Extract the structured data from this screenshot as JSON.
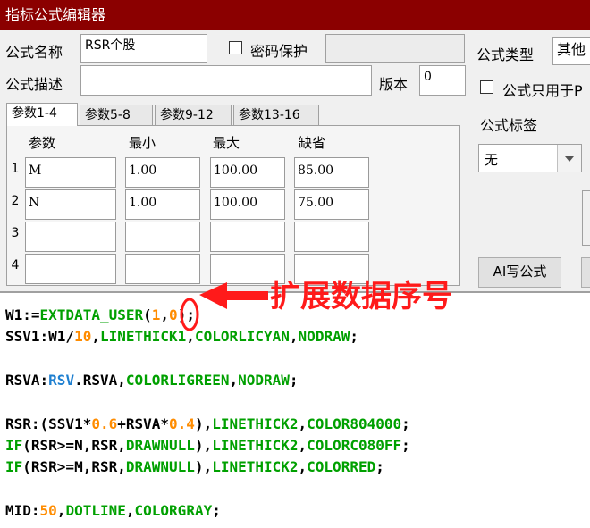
{
  "window": {
    "title": "指标公式编辑器"
  },
  "form": {
    "name_label": "公式名称",
    "name_value": "RSR个股",
    "password_label": "密码保护",
    "type_label": "公式类型",
    "type_value": "其他",
    "desc_label": "公式描述",
    "desc_value": "",
    "version_label": "版本",
    "version_value": "0",
    "only_for_label": "公式只用于P",
    "tag_label": "公式标签",
    "tag_value": "无",
    "ai_button": "AI写公式"
  },
  "tabs": [
    "参数1-4",
    "参数5-8",
    "参数9-12",
    "参数13-16"
  ],
  "params": {
    "headers": [
      "参数",
      "最小",
      "最大",
      "缺省"
    ],
    "rows": [
      {
        "num": "1",
        "name": "M",
        "min": "1.00",
        "max": "100.00",
        "default": "85.00"
      },
      {
        "num": "2",
        "name": "N",
        "min": "1.00",
        "max": "100.00",
        "default": "75.00"
      },
      {
        "num": "3",
        "name": "",
        "min": "",
        "max": "",
        "default": ""
      },
      {
        "num": "4",
        "name": "",
        "min": "",
        "max": "",
        "default": ""
      }
    ]
  },
  "annotation": {
    "text": "扩展数据序号",
    "color": "#ff1a1a"
  },
  "code": {
    "lines": [
      [
        {
          "t": "W1:=",
          "c": "k"
        },
        {
          "t": "EXTDATA_USER",
          "c": "g"
        },
        {
          "t": "(",
          "c": "k"
        },
        {
          "t": "1",
          "c": "o"
        },
        {
          "t": ",",
          "c": "k"
        },
        {
          "t": "0",
          "c": "o"
        },
        {
          "t": ");",
          "c": "k"
        }
      ],
      [
        {
          "t": "SSV1:W1/",
          "c": "k"
        },
        {
          "t": "10",
          "c": "o"
        },
        {
          "t": ",",
          "c": "k"
        },
        {
          "t": "LINETHICK1",
          "c": "g"
        },
        {
          "t": ",",
          "c": "k"
        },
        {
          "t": "COLORLICYAN",
          "c": "g"
        },
        {
          "t": ",",
          "c": "k"
        },
        {
          "t": "NODRAW",
          "c": "g"
        },
        {
          "t": ";",
          "c": "k"
        }
      ],
      [],
      [
        {
          "t": "RSVA:",
          "c": "k"
        },
        {
          "t": "RSV",
          "c": "b"
        },
        {
          "t": ".RSVA,",
          "c": "k"
        },
        {
          "t": "COLORLIGREEN",
          "c": "g"
        },
        {
          "t": ",",
          "c": "k"
        },
        {
          "t": "NODRAW",
          "c": "g"
        },
        {
          "t": ";",
          "c": "k"
        }
      ],
      [],
      [
        {
          "t": "RSR:(SSV1*",
          "c": "k"
        },
        {
          "t": "0.6",
          "c": "o"
        },
        {
          "t": "+RSVA*",
          "c": "k"
        },
        {
          "t": "0.4",
          "c": "o"
        },
        {
          "t": "),",
          "c": "k"
        },
        {
          "t": "LINETHICK2",
          "c": "g"
        },
        {
          "t": ",",
          "c": "k"
        },
        {
          "t": "COLOR804000",
          "c": "g"
        },
        {
          "t": ";",
          "c": "k"
        }
      ],
      [
        {
          "t": "IF",
          "c": "g"
        },
        {
          "t": "(RSR>=N,RSR,",
          "c": "k"
        },
        {
          "t": "DRAWNULL",
          "c": "g"
        },
        {
          "t": "),",
          "c": "k"
        },
        {
          "t": "LINETHICK2",
          "c": "g"
        },
        {
          "t": ",",
          "c": "k"
        },
        {
          "t": "COLORC080FF",
          "c": "g"
        },
        {
          "t": ";",
          "c": "k"
        }
      ],
      [
        {
          "t": "IF",
          "c": "g"
        },
        {
          "t": "(RSR>=M,RSR,",
          "c": "k"
        },
        {
          "t": "DRAWNULL",
          "c": "g"
        },
        {
          "t": "),",
          "c": "k"
        },
        {
          "t": "LINETHICK2",
          "c": "g"
        },
        {
          "t": ",",
          "c": "k"
        },
        {
          "t": "COLORRED",
          "c": "g"
        },
        {
          "t": ";",
          "c": "k"
        }
      ],
      [],
      [
        {
          "t": "MID:",
          "c": "k"
        },
        {
          "t": "50",
          "c": "o"
        },
        {
          "t": ",",
          "c": "k"
        },
        {
          "t": "DOTLINE",
          "c": "g"
        },
        {
          "t": ",",
          "c": "k"
        },
        {
          "t": "COLORGRAY",
          "c": "g"
        },
        {
          "t": ";",
          "c": "k"
        }
      ]
    ]
  }
}
